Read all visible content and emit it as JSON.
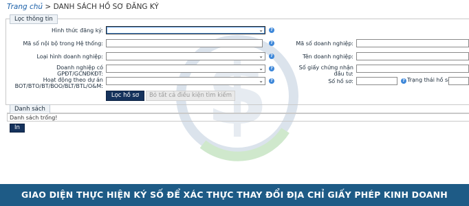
{
  "breadcrumb": {
    "home": "Trang chủ",
    "separator": " > ",
    "current": "DANH SÁCH HỒ SƠ ĐĂNG KÝ"
  },
  "filter": {
    "legend": "Lọc thông tin",
    "labels": {
      "registration_form": "Hình thức đăng ký:",
      "internal_code": "Mã số nội bộ trong Hệ thống:",
      "business_type": "Loại hình doanh nghiệp:",
      "has_license": "Doanh nghiệp có GPĐT/GCNĐKĐT:",
      "project_activity": "Hoạt động theo dự án BOT/BTO/BT/BOO/BLT/BTL/O&M:",
      "enterprise_code": "Mã số doanh nghiệp:",
      "enterprise_name": "Tên doanh nghiệp:",
      "certificate_number": "Số giấy chứng nhận đầu tư:",
      "file_number": "Số hồ sơ:",
      "file_status": "Trạng thái hồ sơ:"
    },
    "help_icon_text": "?",
    "filter_button": "Lọc hồ sơ",
    "clear_button": "Bỏ tất cả điều kiện tìm kiếm"
  },
  "list": {
    "legend": "Danh sách",
    "empty_text": "Danh sách trống!",
    "print_button": "In"
  },
  "footer": {
    "caption": "GIAO DIỆN THỰC HIỆN KÝ SỐ ĐỂ XÁC THỰC THAY ĐỔI ĐỊA CHỈ GIẤY PHÉP KINH DOANH"
  },
  "colors": {
    "primary": "#15325c",
    "footer": "#1e5b86",
    "link": "#1a5fa8",
    "help": "#3d87d9"
  }
}
